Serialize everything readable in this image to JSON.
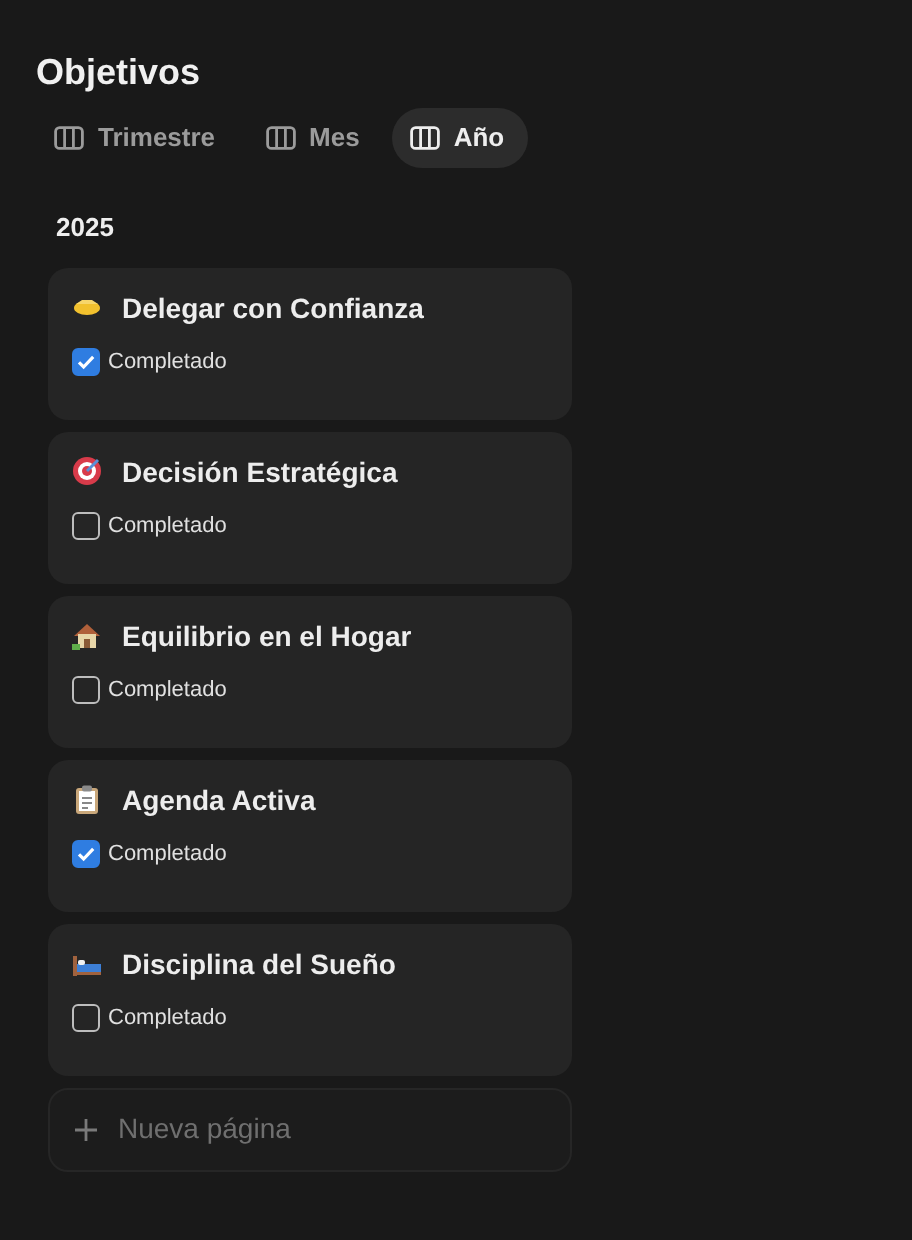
{
  "title": "Objetivos",
  "tabs": [
    {
      "label": "Trimestre",
      "selected": false
    },
    {
      "label": "Mes",
      "selected": false
    },
    {
      "label": "Año",
      "selected": true
    }
  ],
  "group": "2025",
  "cards": [
    {
      "title": "Delegar con Confianza",
      "checkbox_label": "Completado",
      "checked": true
    },
    {
      "title": "Decisión Estratégica",
      "checkbox_label": "Completado",
      "checked": false
    },
    {
      "title": "Equilibrio en el Hogar",
      "checkbox_label": "Completado",
      "checked": false
    },
    {
      "title": "Agenda Activa",
      "checkbox_label": "Completado",
      "checked": true
    },
    {
      "title": "Disciplina del Sueño",
      "checkbox_label": "Completado",
      "checked": false
    }
  ],
  "new_page": "Nueva página"
}
